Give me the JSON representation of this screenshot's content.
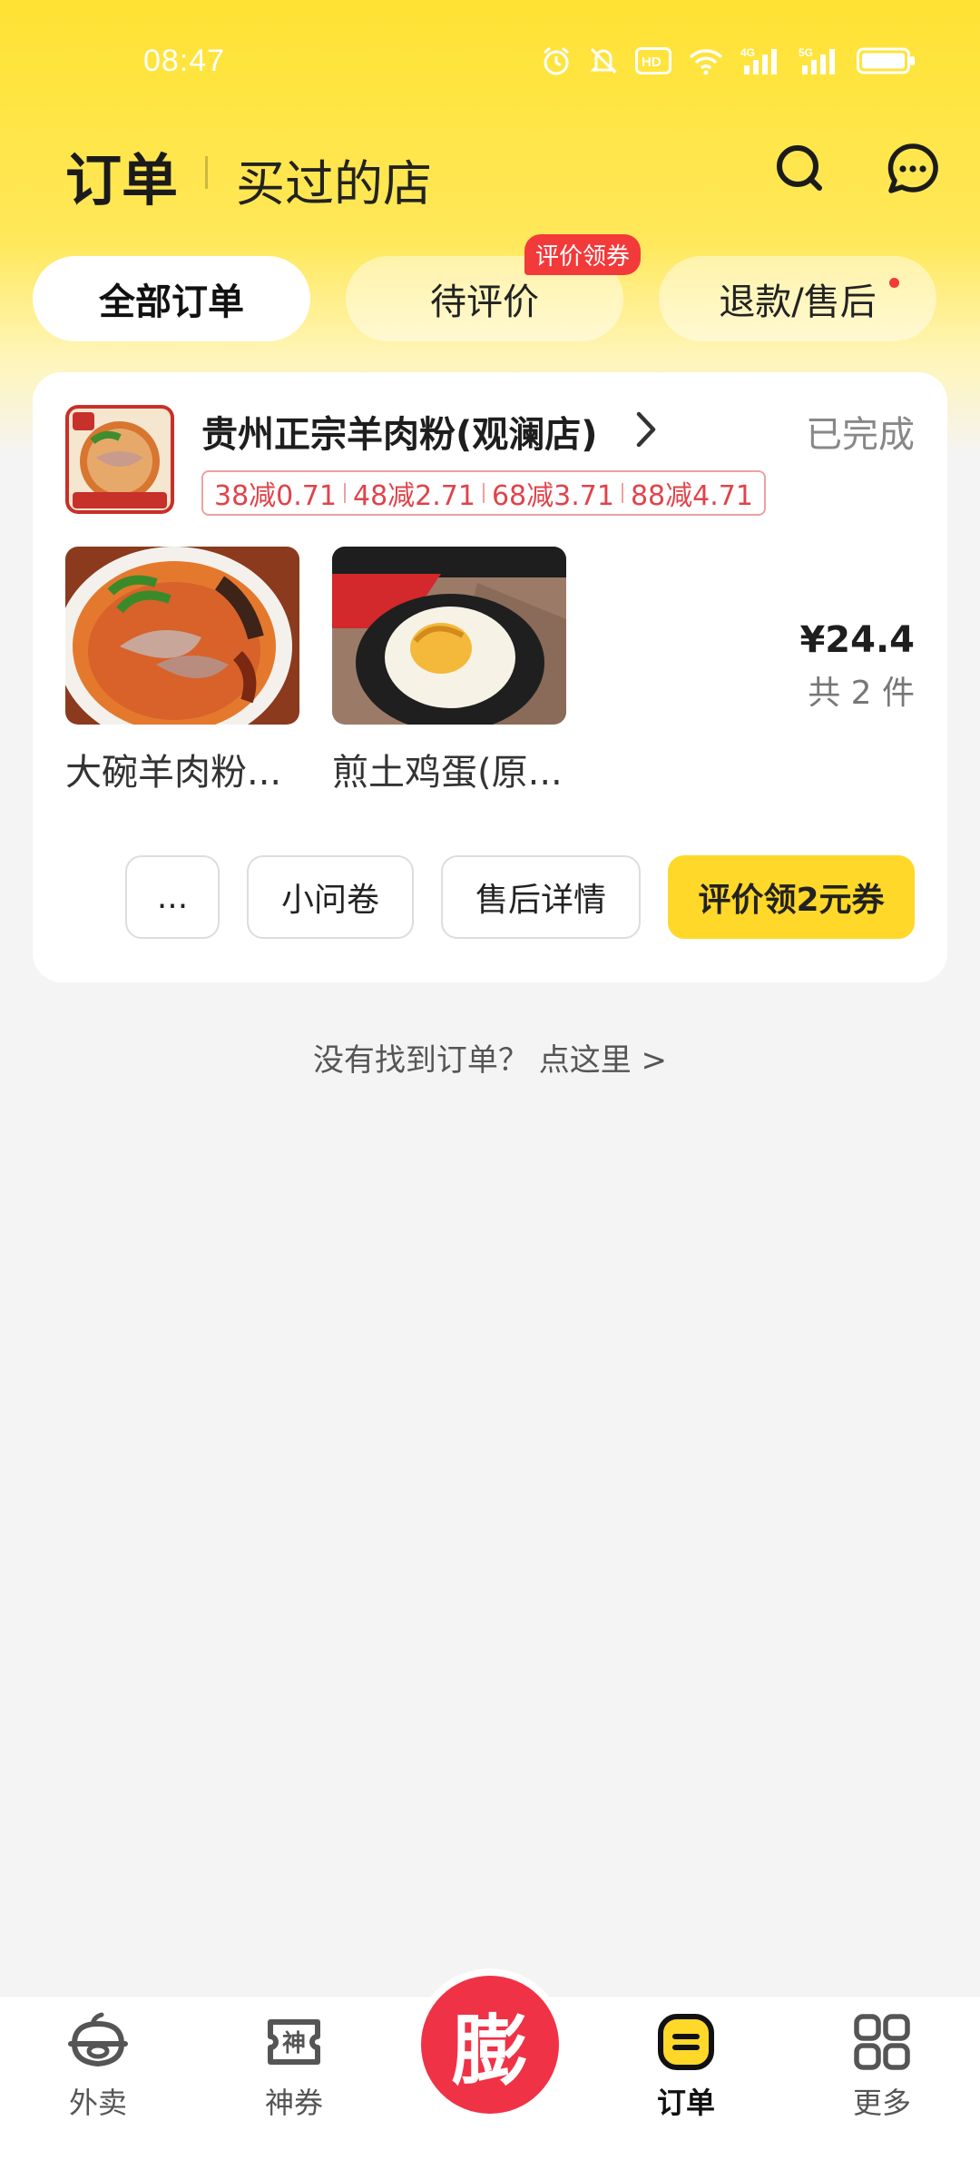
{
  "status_bar": {
    "time": "08:47",
    "icons": [
      "alarm-icon",
      "mute-icon",
      "hd-icon",
      "wifi-icon",
      "signal-4g-icon",
      "signal-5g-icon",
      "battery-icon"
    ]
  },
  "header": {
    "title": "订单",
    "subtitle": "买过的店",
    "icons": [
      "search-icon",
      "message-icon"
    ]
  },
  "tabs": [
    {
      "label": "全部订单",
      "active": true
    },
    {
      "label": "待评价",
      "badge": "评价领券"
    },
    {
      "label": "退款/售后",
      "dot": true
    }
  ],
  "order": {
    "shop_name": "贵州正宗羊肉粉(观澜店)",
    "status": "已完成",
    "promos": [
      "38减0.71",
      "48减2.71",
      "68减3.71",
      "88减4.71"
    ],
    "items": [
      {
        "name": "大碗羊肉粉..."
      },
      {
        "name": "煎土鸡蛋(原..."
      }
    ],
    "price": "¥24.4",
    "count": "共 2 件",
    "actions": {
      "more": "...",
      "survey": "小问卷",
      "after_sales": "售后详情",
      "review": "评价领2元券"
    }
  },
  "not_found": "没有找到订单？ 点这里 >",
  "nav": {
    "items": [
      {
        "label": "外卖",
        "icon": "bowl-icon"
      },
      {
        "label": "神券",
        "icon": "coupon-icon"
      },
      {
        "label": "订单",
        "icon": "order-icon",
        "active": true
      },
      {
        "label": "更多",
        "icon": "grid-icon"
      }
    ],
    "center_glyph": "膨"
  },
  "colors": {
    "brand_yellow": "#ffd829",
    "red": "#f03246",
    "promo_red": "#e0434a"
  }
}
